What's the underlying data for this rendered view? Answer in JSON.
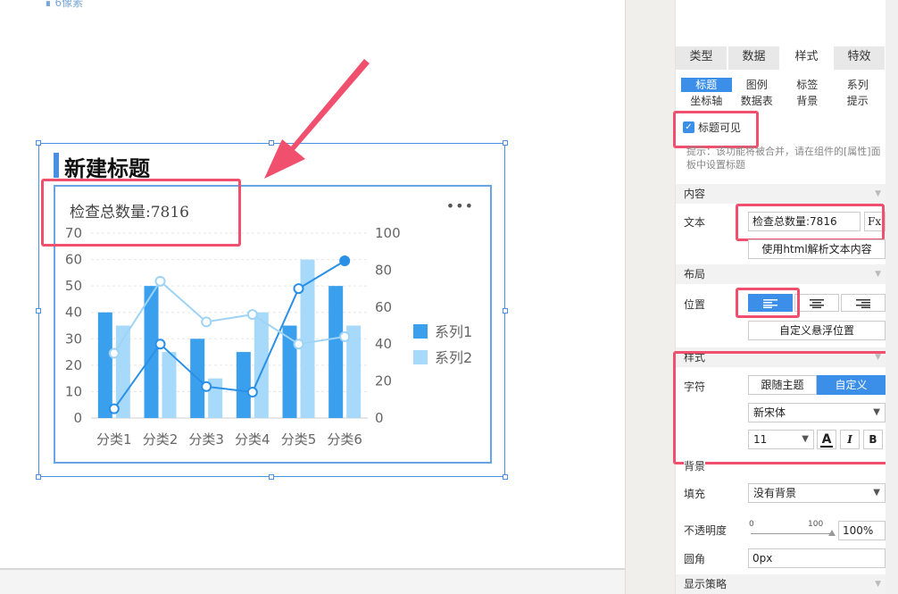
{
  "canvas": {
    "top_note": "∎ 6像素",
    "widget": {
      "title": "新建标题"
    },
    "chart": {
      "title": "检查总数量:7816",
      "more_icon": "more-dots-icon"
    }
  },
  "chart_data": {
    "type": "bar",
    "title": "检查总数量:7816",
    "categories": [
      "分类1",
      "分类2",
      "分类3",
      "分类4",
      "分类5",
      "分类6"
    ],
    "y_left": {
      "ticks": [
        0,
        10,
        20,
        30,
        40,
        50,
        60,
        70
      ],
      "ylim": [
        0,
        70
      ]
    },
    "y_right": {
      "ticks": [
        0,
        20,
        40,
        60,
        80,
        100
      ],
      "ylim": [
        0,
        100
      ]
    },
    "series": [
      {
        "name": "系列1",
        "type": "bar",
        "axis": "left",
        "color": "#3aa0ee",
        "values": [
          40,
          50,
          30,
          25,
          35,
          50
        ]
      },
      {
        "name": "系列2",
        "type": "bar",
        "axis": "left",
        "color": "#a7dafa",
        "values": [
          35,
          25,
          15,
          40,
          60,
          35
        ]
      },
      {
        "type": "line",
        "axis": "right",
        "color": "#2a8fe6",
        "values": [
          5,
          40,
          17,
          14,
          70,
          85
        ]
      },
      {
        "type": "line",
        "axis": "right",
        "color": "#9fd3f5",
        "values": [
          35,
          74,
          52,
          56,
          40,
          44
        ]
      }
    ],
    "legend": {
      "position": "right",
      "items": [
        "系列1",
        "系列2"
      ]
    },
    "grid": true
  },
  "panel": {
    "tabs": [
      {
        "label": "类型",
        "active": false
      },
      {
        "label": "数据",
        "active": false
      },
      {
        "label": "样式",
        "active": true
      },
      {
        "label": "特效",
        "active": false
      }
    ],
    "subtabs": [
      {
        "label": "标题",
        "active": true
      },
      {
        "label": "图例",
        "active": false
      },
      {
        "label": "标签",
        "active": false
      },
      {
        "label": "系列",
        "active": false
      },
      {
        "label": "坐标轴",
        "active": false
      },
      {
        "label": "数据表",
        "active": false
      },
      {
        "label": "背景",
        "active": false
      },
      {
        "label": "提示",
        "active": false
      }
    ],
    "title_visible": {
      "label": "标题可见",
      "checked": true
    },
    "hint": "提示：该功能将被合并，请在组件的[属性]面板中设置标题",
    "content": {
      "section": "内容",
      "text_label": "文本",
      "text_value": "检查总数量:7816",
      "fx_label": "Fx",
      "html_button": "使用html解析文本内容"
    },
    "layout": {
      "section": "布局",
      "position_label": "位置",
      "align": [
        "left",
        "center",
        "right"
      ],
      "active_align": "left",
      "custom_float_button": "自定义悬浮位置"
    },
    "style": {
      "section": "样式",
      "font_label": "字符",
      "theme_options": [
        "跟随主题",
        "自定义"
      ],
      "active_theme": "自定义",
      "font_family": "新宋体",
      "font_size": "11",
      "color_icon": "font-color-icon",
      "italic": "I",
      "bold": "B"
    },
    "background": {
      "section": "背景",
      "fill_label": "填充",
      "fill_value": "没有背景",
      "opacity_label": "不透明度",
      "slider_min": "0",
      "slider_max": "100",
      "opacity_value": "100%",
      "radius_label": "圆角",
      "radius_value": "0px"
    },
    "display_strategy": {
      "section": "显示策略"
    }
  },
  "colors": {
    "accent": "#3b8fe8",
    "annotation": "#f0506e"
  }
}
